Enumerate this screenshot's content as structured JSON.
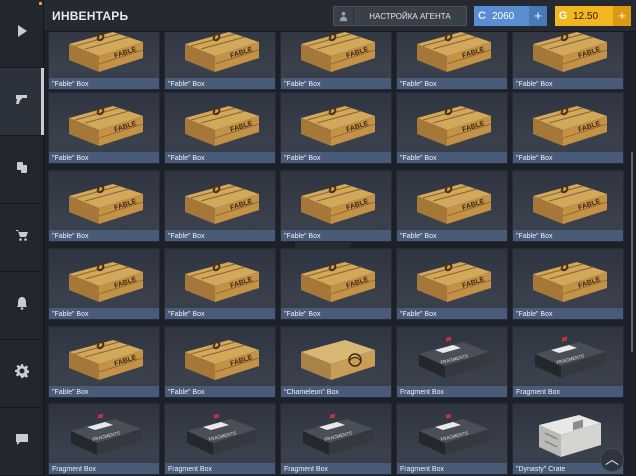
{
  "header": {
    "title": "ИНВЕНТАРЬ",
    "agent_button": "НАСТРОЙКА АГЕНТА",
    "coins": {
      "icon": "C",
      "value": "2060",
      "plus": "+"
    },
    "gold": {
      "icon": "G",
      "value": "12.50",
      "plus": "+"
    }
  },
  "sidebar": {
    "items": [
      {
        "icon": "play-icon"
      },
      {
        "icon": "pistol-icon",
        "active": true
      },
      {
        "icon": "cards-icon"
      },
      {
        "icon": "cart-icon"
      },
      {
        "icon": "bell-icon"
      },
      {
        "icon": "gear-icon"
      },
      {
        "icon": "chat-icon"
      }
    ]
  },
  "inventory": {
    "rows": [
      [
        "\"Fable\" Box",
        "\"Fable\" Box",
        "\"Fable\" Box",
        "\"Fable\" Box",
        "\"Fable\" Box"
      ],
      [
        "\"Fable\" Box",
        "\"Fable\" Box",
        "\"Fable\" Box",
        "\"Fable\" Box",
        "\"Fable\" Box"
      ],
      [
        "\"Fable\" Box",
        "\"Fable\" Box",
        "\"Fable\" Box",
        "\"Fable\" Box",
        "\"Fable\" Box"
      ],
      [
        "\"Fable\" Box",
        "\"Fable\" Box",
        "\"Fable\" Box",
        "\"Fable\" Box",
        "\"Fable\" Box"
      ],
      [
        "\"Fable\" Box",
        "\"Fable\" Box",
        "\"Chameleon\" Box",
        "Fragment Box",
        "Fragment Box"
      ],
      [
        "Fragment Box",
        "Fragment Box",
        "Fragment Box",
        "Fragment Box",
        "\"Dynasty\" Crate"
      ]
    ],
    "types": [
      [
        "fable",
        "fable",
        "fable",
        "fable",
        "fable"
      ],
      [
        "fable",
        "fable",
        "fable",
        "fable",
        "fable"
      ],
      [
        "fable",
        "fable",
        "fable",
        "fable",
        "fable"
      ],
      [
        "fable",
        "fable",
        "fable",
        "fable",
        "fable"
      ],
      [
        "fable",
        "fable",
        "chameleon",
        "fragment",
        "fragment"
      ],
      [
        "fragment",
        "fragment",
        "fragment",
        "fragment",
        "dynasty"
      ]
    ],
    "fable_box_text": "FABLE",
    "fragment_box_text": "FRAGMENTS"
  },
  "scroll_top_button": "︿"
}
